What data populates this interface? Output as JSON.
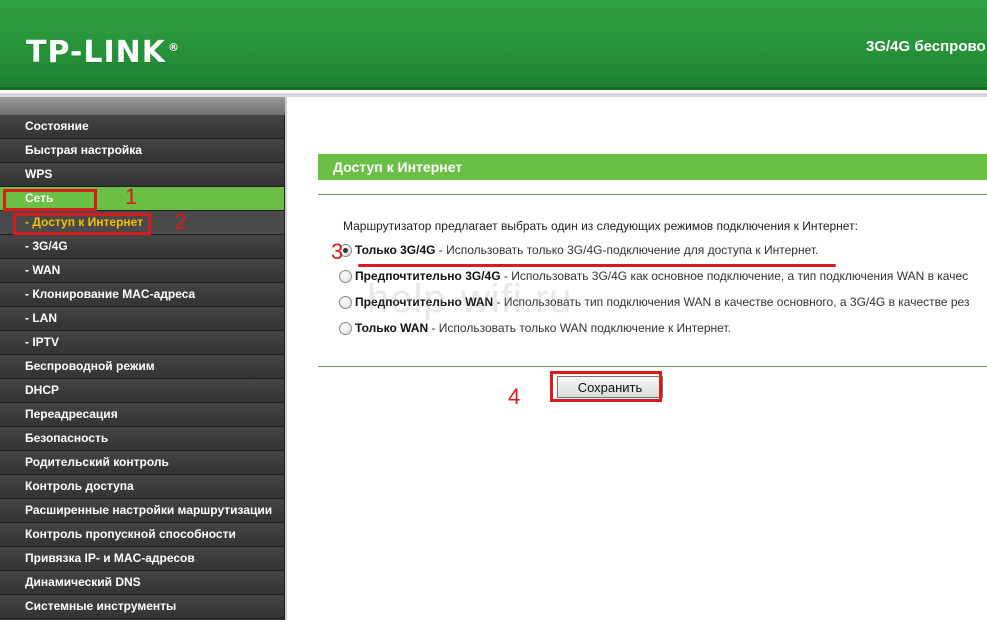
{
  "header": {
    "logo": "TP-LINK",
    "logo_mark": "®",
    "title": "3G/4G беспрово"
  },
  "sidebar": {
    "items": [
      {
        "label": "Состояние",
        "type": "main",
        "active": false
      },
      {
        "label": "Быстрая настройка",
        "type": "main",
        "active": false
      },
      {
        "label": "WPS",
        "type": "main",
        "active": false
      },
      {
        "label": "Сеть",
        "type": "main",
        "active": true
      },
      {
        "label": "- Доступ к Интернет",
        "type": "sub",
        "active": true
      },
      {
        "label": "- 3G/4G",
        "type": "sub",
        "active": false
      },
      {
        "label": "- WAN",
        "type": "sub",
        "active": false
      },
      {
        "label": "- Клонирование MAC-адреса",
        "type": "sub",
        "active": false
      },
      {
        "label": "- LAN",
        "type": "sub",
        "active": false
      },
      {
        "label": "- IPTV",
        "type": "sub",
        "active": false
      },
      {
        "label": "Беспроводной режим",
        "type": "main",
        "active": false
      },
      {
        "label": "DHCP",
        "type": "main",
        "active": false
      },
      {
        "label": "Переадресация",
        "type": "main",
        "active": false
      },
      {
        "label": "Безопасность",
        "type": "main",
        "active": false
      },
      {
        "label": "Родительский контроль",
        "type": "main",
        "active": false
      },
      {
        "label": "Контроль доступа",
        "type": "main",
        "active": false
      },
      {
        "label": "Расширенные настройки маршрутизации",
        "type": "main",
        "active": false
      },
      {
        "label": "Контроль пропускной способности",
        "type": "main",
        "active": false
      },
      {
        "label": "Привязка IP- и MAC-адресов",
        "type": "main",
        "active": false
      },
      {
        "label": "Динамический DNS",
        "type": "main",
        "active": false
      },
      {
        "label": "Системные инструменты",
        "type": "main",
        "active": false
      }
    ]
  },
  "main": {
    "section_title": "Доступ к Интернет",
    "intro": "Маршрутизатор предлагает выбрать один из следующих режимов подключения к Интернет:",
    "options": [
      {
        "name": "Только 3G/4G",
        "desc": " - Использовать только 3G/4G-подключение для доступа к Интернет.",
        "checked": true
      },
      {
        "name": "Предпочтительно 3G/4G",
        "desc": " - Использовать 3G/4G как основное подключение, а тип подключения WAN в качес",
        "checked": false
      },
      {
        "name": "Предпочтительно WAN",
        "desc": " - Использовать тип подключения WAN в качестве основного, а 3G/4G в качестве рез",
        "checked": false
      },
      {
        "name": "Только WAN",
        "desc": " - Использовать только WAN подключение к Интернет.",
        "checked": false
      }
    ],
    "save_label": "Сохранить"
  },
  "annotations": {
    "numbers": [
      "1",
      "2",
      "3",
      "4"
    ],
    "color": "#d91b1b"
  },
  "watermark": "help-wifi.ru",
  "colors": {
    "header_green": "#27933a",
    "accent_green": "#6cbf45",
    "sidebar_bg": "#3b3b3b",
    "submenu_active_text": "#f2c200"
  }
}
